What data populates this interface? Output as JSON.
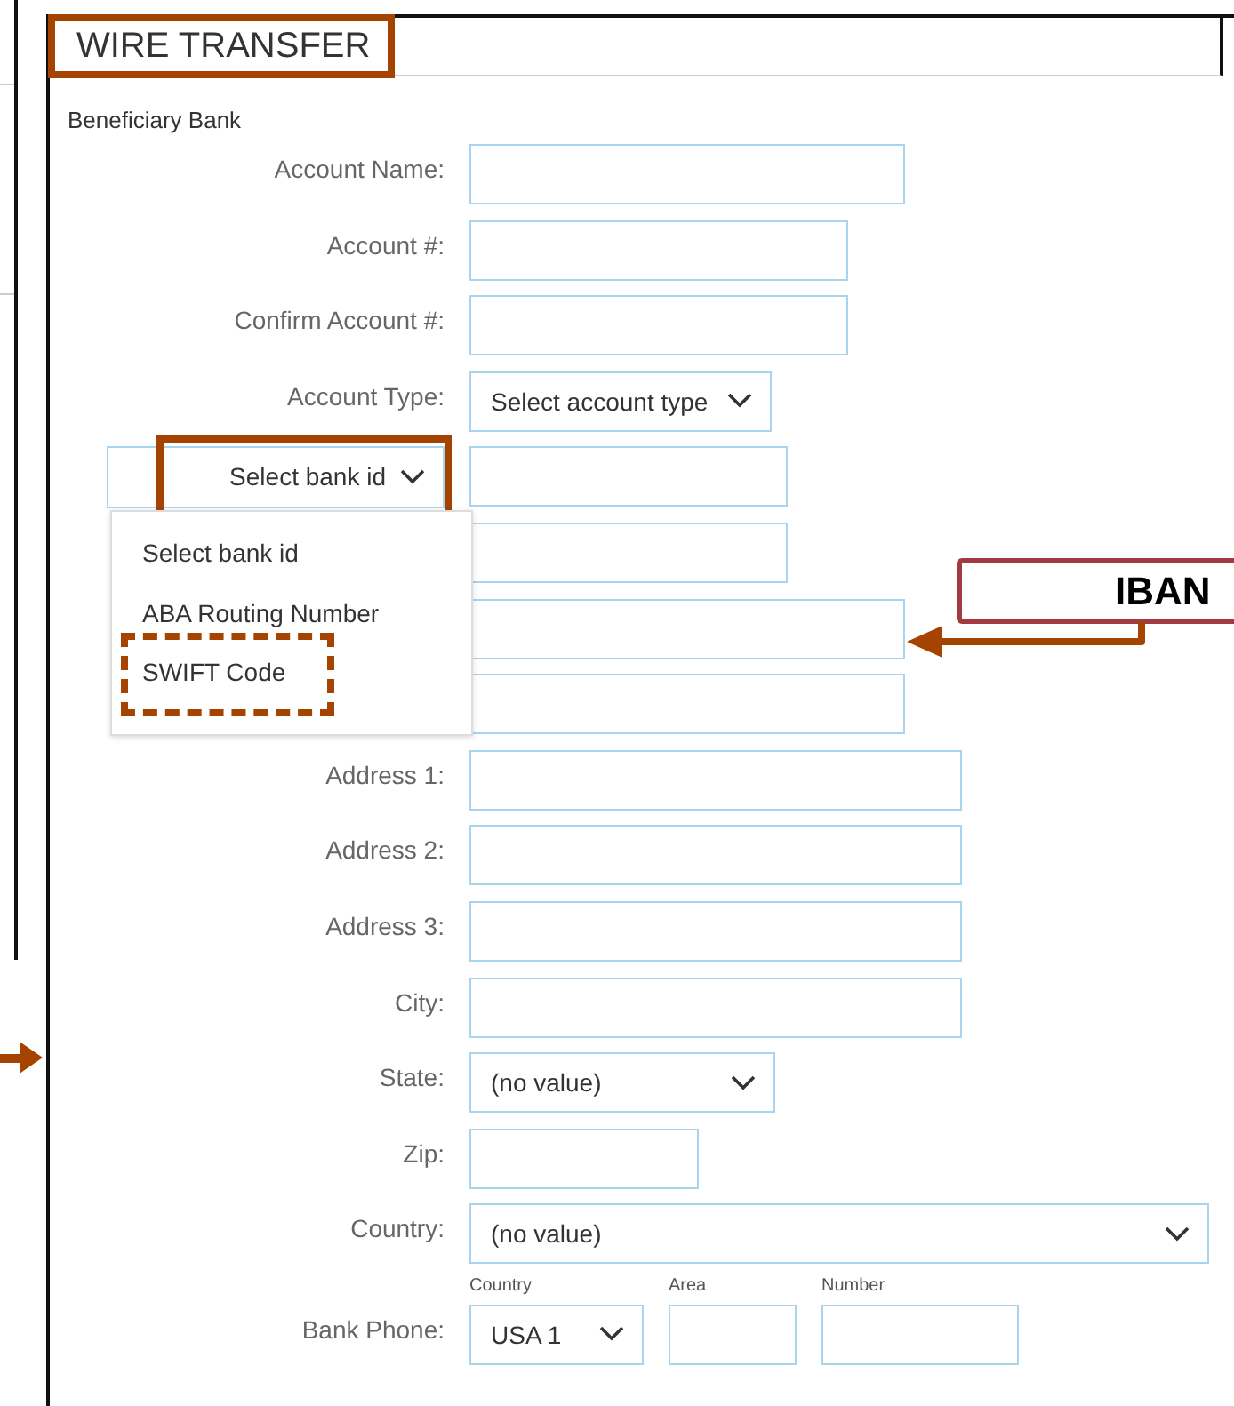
{
  "title": {
    "text": "WIRE TRANSFER",
    "outlined": true
  },
  "section": "Beneficiary Bank",
  "rows": [
    {
      "kind": "text",
      "label": "Account Name:"
    },
    {
      "kind": "text",
      "label": "Account #:"
    },
    {
      "kind": "text",
      "label": "Confirm Account #:"
    },
    {
      "kind": "select",
      "label": "Account Type:",
      "value": "Select account type"
    },
    {
      "kind": "bank_id",
      "value": "Select bank id",
      "outlined": true,
      "menu": [
        {
          "text": "Select bank id",
          "outlined": false
        },
        {
          "text": "ABA Routing Number",
          "outlined": false
        },
        {
          "text": "SWIFT Code",
          "outlined": true
        }
      ]
    },
    {
      "kind": "text"
    },
    {
      "kind": "text"
    },
    {
      "kind": "text"
    },
    {
      "kind": "text",
      "label": "Address 1:"
    },
    {
      "kind": "text",
      "label": "Address 2:"
    },
    {
      "kind": "text",
      "label": "Address 3:"
    },
    {
      "kind": "text",
      "label": "City:"
    },
    {
      "kind": "select",
      "label": "State:",
      "value": "(no value)"
    },
    {
      "kind": "text",
      "label": "Zip:"
    },
    {
      "kind": "select",
      "label": "Country:",
      "value": "(no value)"
    },
    {
      "kind": "phone",
      "label": "Bank Phone:",
      "parts": [
        {
          "caption": "Country",
          "kind": "select",
          "value": "USA 1"
        },
        {
          "caption": "Area",
          "kind": "text"
        },
        {
          "caption": "Number",
          "kind": "text"
        }
      ]
    }
  ],
  "callout": {
    "text": "IBAN"
  }
}
